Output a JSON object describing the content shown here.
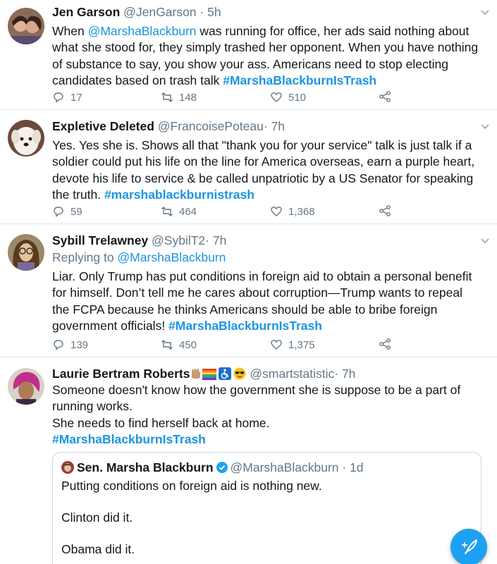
{
  "colors": {
    "link": "#1b95e0",
    "muted": "#657786",
    "fab": "#1da1f2"
  },
  "tweets": [
    {
      "name": "Jen Garson",
      "handle": "@JenGarson",
      "dot": "·",
      "time": "5h",
      "lines": [
        [
          "When ",
          "@MarshaBlackburn",
          " was running for office, her ads said nothing about"
        ],
        [
          "what she stood for, they simply trashed her opponent. When you have nothing"
        ],
        [
          "of substance to say, you show your ass. Americans need to stop electing"
        ],
        [
          "candidates based on trash talk ",
          "#MarshaBlackburnIsTrash"
        ]
      ],
      "replies": "17",
      "retweets": "148",
      "likes": "510"
    },
    {
      "name": "Expletive Deleted",
      "handle": "@FrancoisePoteau",
      "dot": "·",
      "time": "7h",
      "lines": [
        [
          "Yes. Yes she is. Shows all that \"thank you for your service\" talk is just talk if a"
        ],
        [
          "soldier could put his life on the line for America overseas, earn a purple heart,"
        ],
        [
          "devote his life to service & be called unpatriotic by a US Senator for speaking"
        ],
        [
          "the truth. ",
          "#marshablackburnistrash"
        ]
      ],
      "replies": "59",
      "retweets": "464",
      "likes": "1,368"
    },
    {
      "name": "Sybill Trelawney",
      "handle": "@SybilT2",
      "dot": "·",
      "time": "7h",
      "reply_label": "Replying to ",
      "reply_to": "@MarshaBlackburn",
      "lines": [
        [
          "Liar. Only Trump has put conditions in foreign aid to obtain a personal benefit"
        ],
        [
          "for himself. Don’t tell me he cares about corruption—Trump wants to repeal"
        ],
        [
          "the FCPA because he thinks Americans should be able to bribe foreign"
        ],
        [
          "government officials! ",
          "#MarshaBlackburnIsTrash"
        ]
      ],
      "replies": "139",
      "retweets": "450",
      "likes": "1,375"
    },
    {
      "name": "Laurie Bertram Roberts",
      "emojis": [
        "raised-fist-icon",
        "rainbow-flag-icon",
        "wheelchair-icon",
        "sunglasses-face-icon"
      ],
      "handle": "@smartstatistic",
      "dot": "·",
      "time": "7h",
      "lines": [
        [
          "Someone doesn't know how the government she is suppose to be a part of"
        ],
        [
          "running works."
        ],
        [
          "She needs to find herself back at home."
        ],
        [
          "#MarshaBlackburnIsTrash"
        ]
      ],
      "quote": {
        "name": "Sen. Marsha Blackburn",
        "handle": "@MarshaBlackburn",
        "dot": "·",
        "time": "1d",
        "line1": "Putting conditions on foreign aid is nothing new.",
        "line2": "Clinton did it.",
        "line3": "Obama did it."
      }
    }
  ],
  "fab": {
    "icon": "compose-tweet-icon"
  }
}
